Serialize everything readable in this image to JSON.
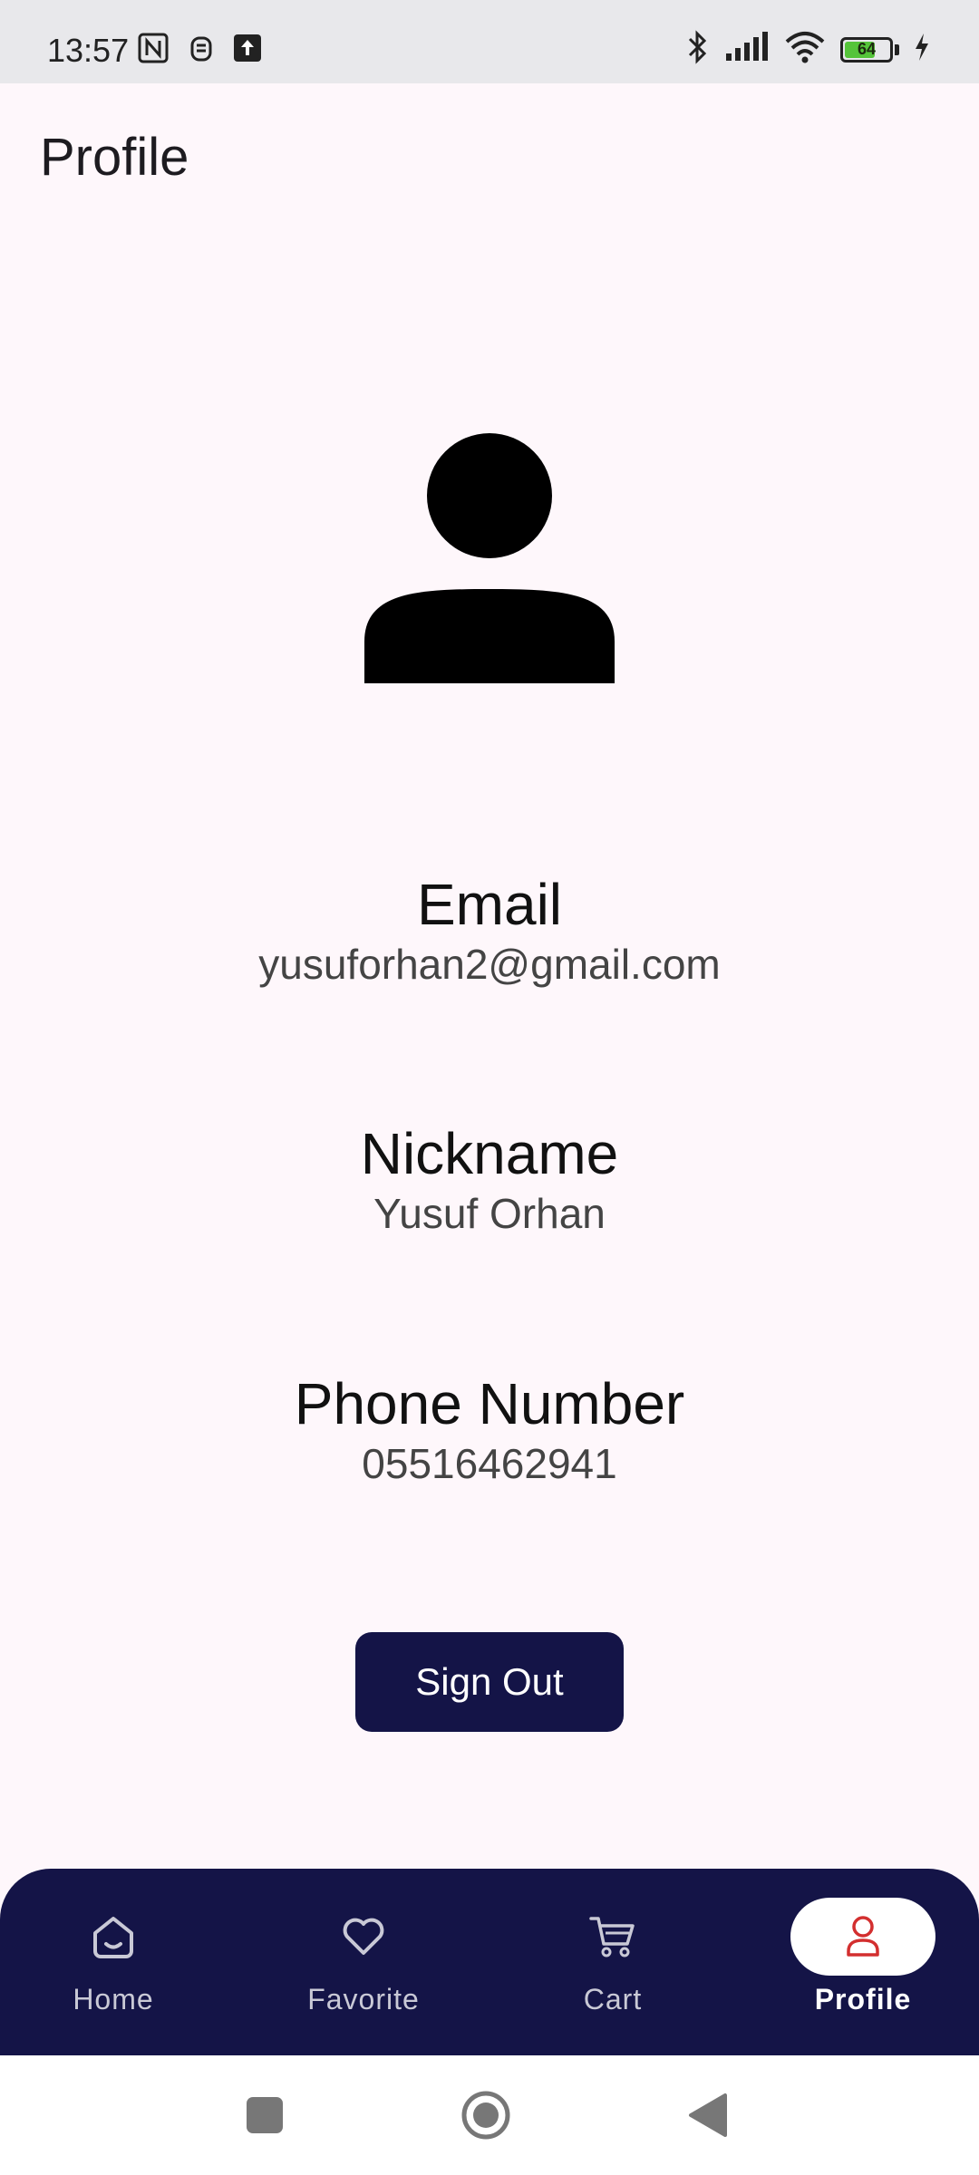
{
  "status_bar": {
    "time": "13:57",
    "battery_level": "64",
    "icons": [
      "nfc-icon",
      "alarm-icon",
      "upload-icon",
      "bluetooth-icon",
      "signal-icon",
      "wifi-icon",
      "battery-icon",
      "charging-icon"
    ]
  },
  "header": {
    "title": "Profile"
  },
  "profile": {
    "avatar_icon": "person-icon",
    "email_label": "Email",
    "email_value": "yusuforhan2@gmail.com",
    "nickname_label": "Nickname",
    "nickname_value": "Yusuf Orhan",
    "phone_label": "Phone Number",
    "phone_value": "05516462941",
    "signout_label": "Sign Out"
  },
  "bottom_nav": {
    "items": [
      {
        "label": "Home",
        "icon": "home-icon",
        "active": false
      },
      {
        "label": "Favorite",
        "icon": "heart-icon",
        "active": false
      },
      {
        "label": "Cart",
        "icon": "cart-icon",
        "active": false
      },
      {
        "label": "Profile",
        "icon": "person-icon",
        "active": true
      }
    ]
  },
  "colors": {
    "background": "#fef7fb",
    "primary": "#141447",
    "active_icon": "#d32f2f",
    "battery": "#55c43a"
  }
}
